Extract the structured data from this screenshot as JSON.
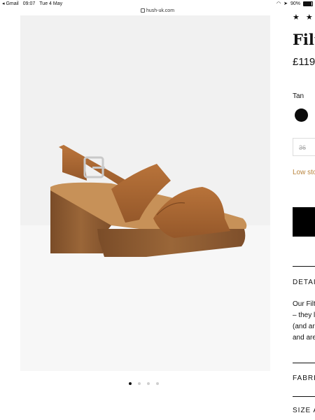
{
  "status_bar": {
    "back_app": "◂ Gmail",
    "time": "09:07",
    "date": "Tue 4 May",
    "battery": "90%"
  },
  "browser": {
    "url": "hush-uk.com"
  },
  "gallery": {
    "slides": 4,
    "active_index": 0
  },
  "product": {
    "stars": "★ ★ ★",
    "title": "Filt",
    "price": "£119",
    "colour_label": "Tan",
    "size_option": "36",
    "stock_notice": "Low sto"
  },
  "sections": {
    "details_heading": "DETAI",
    "description_lines": [
      "Our Filt",
      "– they l",
      "(and are",
      "and are"
    ],
    "fabric_heading": "FABRI",
    "size_heading": "SIZE A"
  },
  "colors": {
    "accent_low_stock": "#b8843d",
    "sandal_tan": "#a5652f",
    "sole_wood": "#8b5a31"
  }
}
